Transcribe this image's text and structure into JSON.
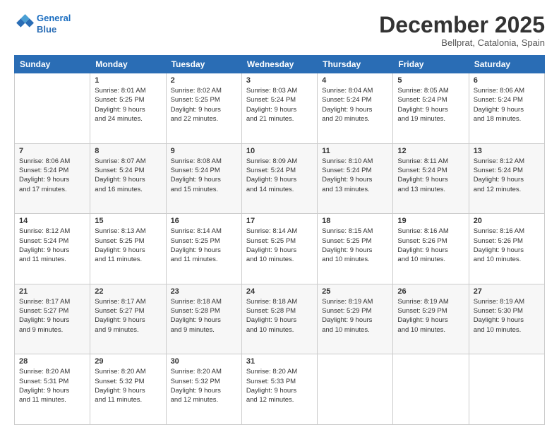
{
  "logo": {
    "line1": "General",
    "line2": "Blue"
  },
  "header": {
    "month": "December 2025",
    "location": "Bellprat, Catalonia, Spain"
  },
  "days_of_week": [
    "Sunday",
    "Monday",
    "Tuesday",
    "Wednesday",
    "Thursday",
    "Friday",
    "Saturday"
  ],
  "weeks": [
    [
      {
        "day": "",
        "info": ""
      },
      {
        "day": "1",
        "info": "Sunrise: 8:01 AM\nSunset: 5:25 PM\nDaylight: 9 hours\nand 24 minutes."
      },
      {
        "day": "2",
        "info": "Sunrise: 8:02 AM\nSunset: 5:25 PM\nDaylight: 9 hours\nand 22 minutes."
      },
      {
        "day": "3",
        "info": "Sunrise: 8:03 AM\nSunset: 5:24 PM\nDaylight: 9 hours\nand 21 minutes."
      },
      {
        "day": "4",
        "info": "Sunrise: 8:04 AM\nSunset: 5:24 PM\nDaylight: 9 hours\nand 20 minutes."
      },
      {
        "day": "5",
        "info": "Sunrise: 8:05 AM\nSunset: 5:24 PM\nDaylight: 9 hours\nand 19 minutes."
      },
      {
        "day": "6",
        "info": "Sunrise: 8:06 AM\nSunset: 5:24 PM\nDaylight: 9 hours\nand 18 minutes."
      }
    ],
    [
      {
        "day": "7",
        "info": "Sunrise: 8:06 AM\nSunset: 5:24 PM\nDaylight: 9 hours\nand 17 minutes."
      },
      {
        "day": "8",
        "info": "Sunrise: 8:07 AM\nSunset: 5:24 PM\nDaylight: 9 hours\nand 16 minutes."
      },
      {
        "day": "9",
        "info": "Sunrise: 8:08 AM\nSunset: 5:24 PM\nDaylight: 9 hours\nand 15 minutes."
      },
      {
        "day": "10",
        "info": "Sunrise: 8:09 AM\nSunset: 5:24 PM\nDaylight: 9 hours\nand 14 minutes."
      },
      {
        "day": "11",
        "info": "Sunrise: 8:10 AM\nSunset: 5:24 PM\nDaylight: 9 hours\nand 13 minutes."
      },
      {
        "day": "12",
        "info": "Sunrise: 8:11 AM\nSunset: 5:24 PM\nDaylight: 9 hours\nand 13 minutes."
      },
      {
        "day": "13",
        "info": "Sunrise: 8:12 AM\nSunset: 5:24 PM\nDaylight: 9 hours\nand 12 minutes."
      }
    ],
    [
      {
        "day": "14",
        "info": "Sunrise: 8:12 AM\nSunset: 5:24 PM\nDaylight: 9 hours\nand 11 minutes."
      },
      {
        "day": "15",
        "info": "Sunrise: 8:13 AM\nSunset: 5:25 PM\nDaylight: 9 hours\nand 11 minutes."
      },
      {
        "day": "16",
        "info": "Sunrise: 8:14 AM\nSunset: 5:25 PM\nDaylight: 9 hours\nand 11 minutes."
      },
      {
        "day": "17",
        "info": "Sunrise: 8:14 AM\nSunset: 5:25 PM\nDaylight: 9 hours\nand 10 minutes."
      },
      {
        "day": "18",
        "info": "Sunrise: 8:15 AM\nSunset: 5:25 PM\nDaylight: 9 hours\nand 10 minutes."
      },
      {
        "day": "19",
        "info": "Sunrise: 8:16 AM\nSunset: 5:26 PM\nDaylight: 9 hours\nand 10 minutes."
      },
      {
        "day": "20",
        "info": "Sunrise: 8:16 AM\nSunset: 5:26 PM\nDaylight: 9 hours\nand 10 minutes."
      }
    ],
    [
      {
        "day": "21",
        "info": "Sunrise: 8:17 AM\nSunset: 5:27 PM\nDaylight: 9 hours\nand 9 minutes."
      },
      {
        "day": "22",
        "info": "Sunrise: 8:17 AM\nSunset: 5:27 PM\nDaylight: 9 hours\nand 9 minutes."
      },
      {
        "day": "23",
        "info": "Sunrise: 8:18 AM\nSunset: 5:28 PM\nDaylight: 9 hours\nand 9 minutes."
      },
      {
        "day": "24",
        "info": "Sunrise: 8:18 AM\nSunset: 5:28 PM\nDaylight: 9 hours\nand 10 minutes."
      },
      {
        "day": "25",
        "info": "Sunrise: 8:19 AM\nSunset: 5:29 PM\nDaylight: 9 hours\nand 10 minutes."
      },
      {
        "day": "26",
        "info": "Sunrise: 8:19 AM\nSunset: 5:29 PM\nDaylight: 9 hours\nand 10 minutes."
      },
      {
        "day": "27",
        "info": "Sunrise: 8:19 AM\nSunset: 5:30 PM\nDaylight: 9 hours\nand 10 minutes."
      }
    ],
    [
      {
        "day": "28",
        "info": "Sunrise: 8:20 AM\nSunset: 5:31 PM\nDaylight: 9 hours\nand 11 minutes."
      },
      {
        "day": "29",
        "info": "Sunrise: 8:20 AM\nSunset: 5:32 PM\nDaylight: 9 hours\nand 11 minutes."
      },
      {
        "day": "30",
        "info": "Sunrise: 8:20 AM\nSunset: 5:32 PM\nDaylight: 9 hours\nand 12 minutes."
      },
      {
        "day": "31",
        "info": "Sunrise: 8:20 AM\nSunset: 5:33 PM\nDaylight: 9 hours\nand 12 minutes."
      },
      {
        "day": "",
        "info": ""
      },
      {
        "day": "",
        "info": ""
      },
      {
        "day": "",
        "info": ""
      }
    ]
  ]
}
